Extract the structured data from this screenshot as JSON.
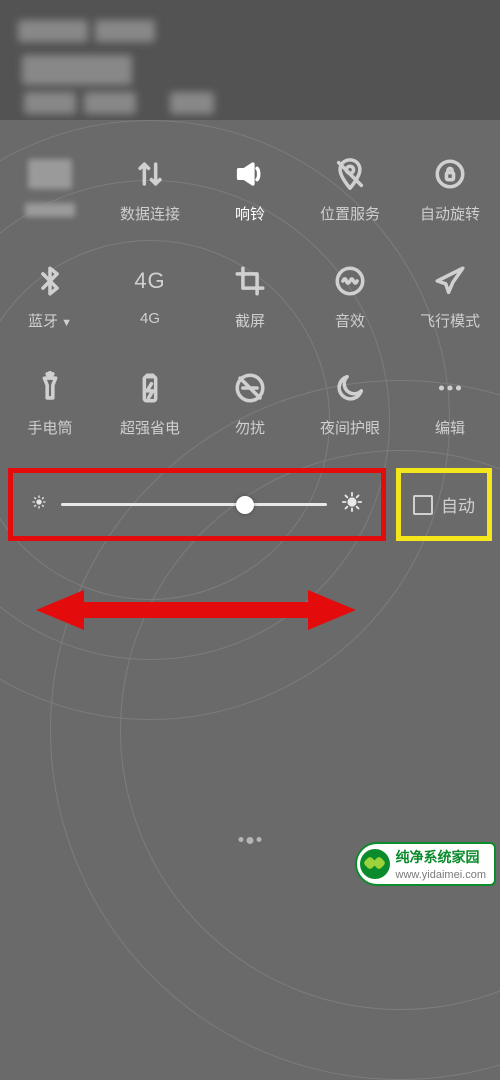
{
  "status": {
    "blurred": true
  },
  "quick_settings": {
    "rows": [
      [
        {
          "id": "wifi",
          "icon": "blurred",
          "label_blurred": true
        },
        {
          "id": "data",
          "icon": "data-arrows",
          "label": "数据连接"
        },
        {
          "id": "ring",
          "icon": "speaker",
          "label": "响铃",
          "active": true
        },
        {
          "id": "location",
          "icon": "location-off",
          "label": "位置服务"
        },
        {
          "id": "rotate",
          "icon": "lock-rotate",
          "label": "自动旋转"
        }
      ],
      [
        {
          "id": "bluetooth",
          "icon": "bluetooth",
          "label": "蓝牙",
          "dropdown": true
        },
        {
          "id": "net4g",
          "icon": "text",
          "text": "4G",
          "label": "4G"
        },
        {
          "id": "screenshot",
          "icon": "crop",
          "label": "截屏"
        },
        {
          "id": "sound",
          "icon": "sound-wave",
          "label": "音效"
        },
        {
          "id": "airplane",
          "icon": "airplane",
          "label": "飞行模式"
        }
      ],
      [
        {
          "id": "flashlight",
          "icon": "flashlight",
          "label": "手电筒"
        },
        {
          "id": "battery",
          "icon": "battery-bolt",
          "label": "超强省电"
        },
        {
          "id": "dnd",
          "icon": "dnd",
          "label": "勿扰"
        },
        {
          "id": "night",
          "icon": "moon",
          "label": "夜间护眼"
        },
        {
          "id": "edit",
          "icon": "dots",
          "label": "编辑"
        }
      ]
    ]
  },
  "brightness": {
    "value_percent": 69,
    "auto_label": "自动",
    "auto_checked": false,
    "slider_highlight_color": "#e30b0b",
    "auto_highlight_color": "#f3e61a"
  },
  "watermark": {
    "name": "纯净系统家园",
    "url": "www.yidaimei.com"
  },
  "annotations": {
    "red_arrow": {
      "direction": "horizontal-double",
      "below": "brightness_slider"
    }
  }
}
